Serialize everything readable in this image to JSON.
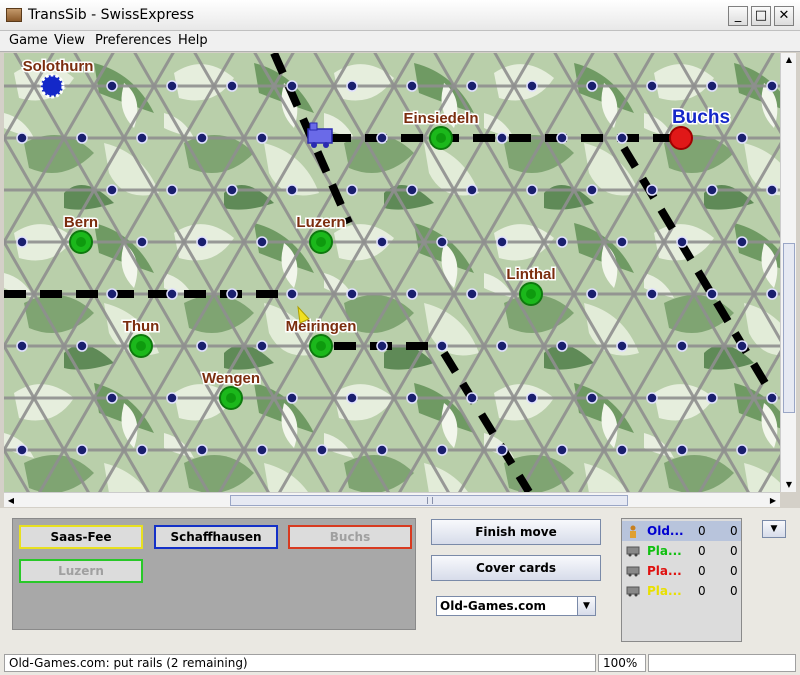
{
  "window": {
    "title": "TransSib - SwissExpress",
    "controls": [
      "_",
      "□",
      "✕"
    ]
  },
  "menu": [
    "Game",
    "View",
    "Preferences",
    "Help"
  ],
  "board": {
    "colors": {
      "background": "#b9cfaa",
      "track": "#8f8f8f",
      "node": "#1a1f6e",
      "rail": "#000000",
      "city_label": "#7b2d0e",
      "city_green": "#1bb81b"
    },
    "cities": [
      {
        "name": "Solothurn",
        "marker": "blue-home"
      },
      {
        "name": "Einsiedeln",
        "marker": "green"
      },
      {
        "name": "Buchs",
        "marker": "red-target"
      },
      {
        "name": "Bern",
        "marker": "green"
      },
      {
        "name": "Luzern",
        "marker": "green"
      },
      {
        "name": "Linthal",
        "marker": "green"
      },
      {
        "name": "Thun",
        "marker": "green"
      },
      {
        "name": "Meiringen",
        "marker": "green"
      },
      {
        "name": "Wengen",
        "marker": "green"
      }
    ],
    "train_icon": "blue-train-icon"
  },
  "cards": {
    "items": [
      {
        "label": "Saas-Fee",
        "border": "#e8e020",
        "text": "#000000"
      },
      {
        "label": "Schaffhausen",
        "border": "#1430c8",
        "text": "#000000"
      },
      {
        "label": "Buchs",
        "border": "#d83a20",
        "text": "#a0a0a0"
      },
      {
        "label": "Luzern",
        "border": "#28c828",
        "text": "#a0a0a0"
      }
    ]
  },
  "controls": {
    "finish_move": "Finish move",
    "cover_cards": "Cover cards",
    "player_select": "Old-Games.com"
  },
  "players": [
    {
      "name": "Old...",
      "color": "#0000d0",
      "icon": "person-icon",
      "score1": "0",
      "score2": "0"
    },
    {
      "name": "Pla...",
      "color": "#10c010",
      "icon": "train-car-icon",
      "score1": "0",
      "score2": "0"
    },
    {
      "name": "Pla...",
      "color": "#e01010",
      "icon": "train-car-icon",
      "score1": "0",
      "score2": "0"
    },
    {
      "name": "Pla...",
      "color": "#e8e000",
      "icon": "train-car-icon",
      "score1": "0",
      "score2": "0"
    }
  ],
  "status": {
    "message": "Old-Games.com: put rails (2 remaining)",
    "zoom": "100%",
    "extra": ""
  }
}
